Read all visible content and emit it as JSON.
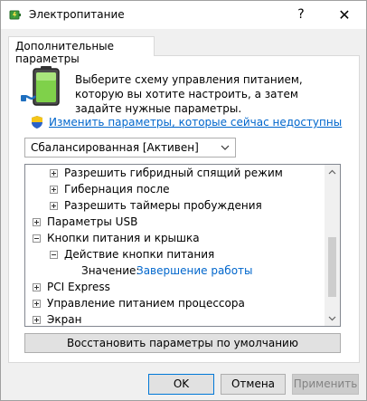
{
  "window": {
    "title": "Электропитание",
    "help_glyph": "?",
    "close_glyph": "✕"
  },
  "tab": {
    "label": "Дополнительные параметры"
  },
  "intro": {
    "icon": "battery-power-icon",
    "text": "Выберите схему управления питанием, которую вы хотите настроить, а затем задайте нужные параметры."
  },
  "change_settings": {
    "icon": "uac-shield-icon",
    "label": "Изменить параметры, которые сейчас недоступны"
  },
  "plan_select": {
    "selected": "Сбалансированная [Активен]"
  },
  "tree": {
    "rows": [
      {
        "label": "Разрешить гибридный спящий режим",
        "expander": "plus"
      },
      {
        "label": "Гибернация после",
        "expander": "plus"
      },
      {
        "label": "Разрешить таймеры пробуждения",
        "expander": "plus"
      },
      {
        "label": "Параметры USB",
        "expander": "plus"
      },
      {
        "label": "Кнопки питания и крышка",
        "expander": "minus"
      },
      {
        "label": "Действие кнопки питания",
        "expander": "minus"
      },
      {
        "label": "Значение:",
        "value": "Завершение работы"
      },
      {
        "label": "PCI Express",
        "expander": "plus"
      },
      {
        "label": "Управление питанием процессора",
        "expander": "plus"
      },
      {
        "label": "Экран",
        "expander": "plus"
      }
    ]
  },
  "buttons": {
    "restore": "Восстановить параметры по умолчанию",
    "ok": "OK",
    "cancel": "Отмена",
    "apply": "Применить"
  },
  "colors": {
    "link": "#0066cc",
    "focus_border": "#0078d7"
  }
}
